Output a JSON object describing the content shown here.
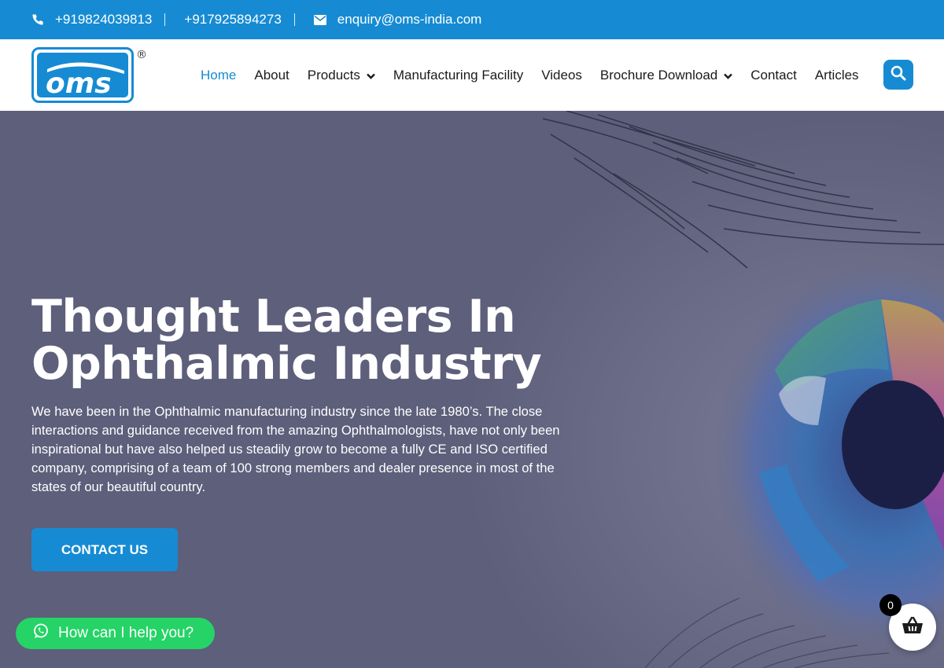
{
  "topbar": {
    "phone1": "+919824039813",
    "phone2": "+917925894273",
    "email": "enquiry@oms-india.com"
  },
  "logo": {
    "text": "oms",
    "trademark": "®"
  },
  "nav": {
    "items": [
      {
        "label": "Home",
        "active": true
      },
      {
        "label": "About"
      },
      {
        "label": "Products",
        "dropdown": true
      },
      {
        "label": "Manufacturing Facility"
      },
      {
        "label": "Videos"
      },
      {
        "label": "Brochure Download",
        "dropdown": true
      },
      {
        "label": "Contact"
      },
      {
        "label": "Articles"
      }
    ]
  },
  "hero": {
    "title_line1": "Thought Leaders In",
    "title_line2": "Ophthalmic Industry",
    "paragraph": "We have been in the Ophthalmic manufacturing industry since the late 1980’s. The close interactions and guidance received from the amazing Ophthalmologists, have not only been inspirational but have also helped us steadily grow to become a fully CE and ISO certified company, comprising of a team of 100 strong members and dealer presence in most of the states of our beautiful country.",
    "cta_label": "CONTACT US"
  },
  "whatsapp": {
    "label": "How can I help you?"
  },
  "cart": {
    "count": "0"
  },
  "colors": {
    "brand_blue": "#168bd3",
    "hero_overlay": "#5d5f7b",
    "whatsapp_green": "#25d366"
  },
  "icons": {
    "phone": "phone-icon",
    "email": "envelope-icon",
    "search": "search-icon",
    "dropdown": "chevron-down-icon",
    "whatsapp": "whatsapp-icon",
    "cart": "basket-icon"
  }
}
